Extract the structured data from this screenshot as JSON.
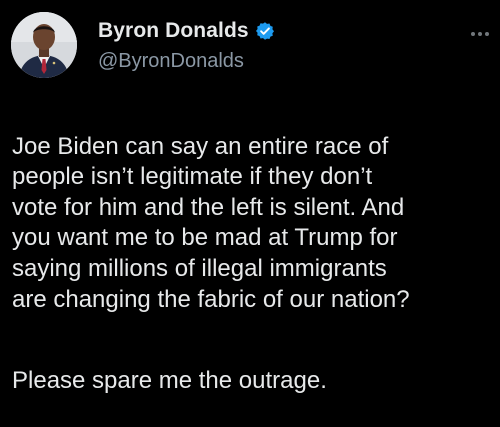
{
  "author": {
    "display_name": "Byron Donalds",
    "handle": "@ByronDonalds",
    "verified": true,
    "avatar_icon": "profile-photo"
  },
  "tweet": {
    "paragraphs": [
      "Joe Biden can say an entire race of\npeople isn’t legitimate if they don’t\nvote for him and the left is silent. And\nyou want me to be mad at Trump for\nsaying millions of illegal immigrants\nare changing the fabric of our nation?",
      "Please spare me the outrage."
    ]
  },
  "colors": {
    "background": "#000000",
    "text_primary": "#e7e9ea",
    "text_secondary": "#8b98a5",
    "verified_badge": "#1d9bf0"
  },
  "icons": {
    "verified": "verified-badge-icon",
    "more": "more-options-icon"
  }
}
